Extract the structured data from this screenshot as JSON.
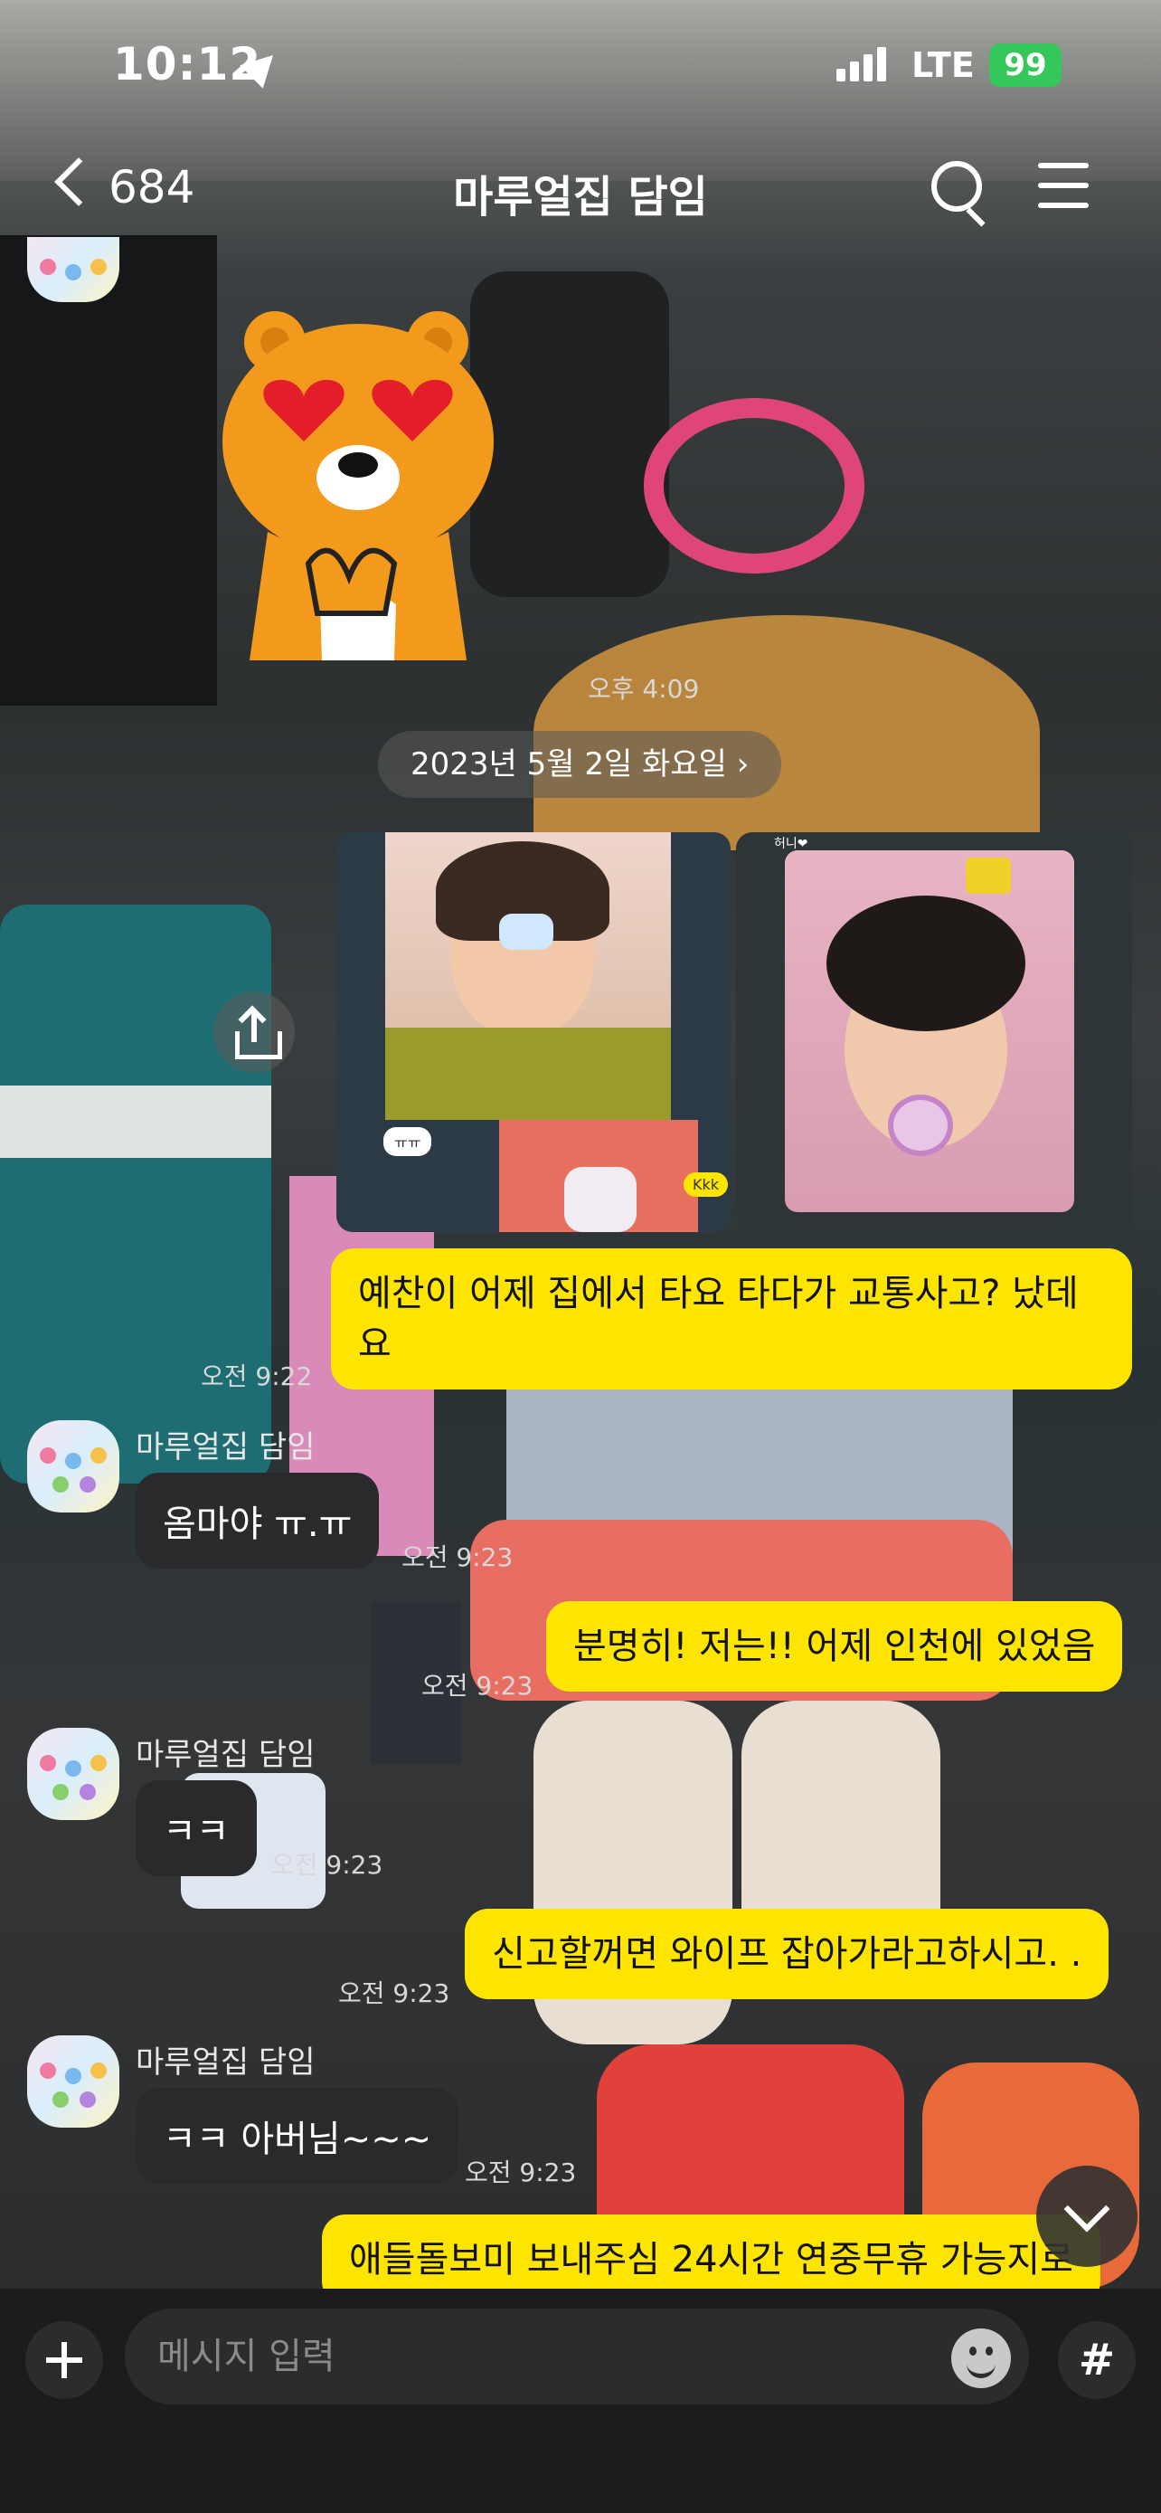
{
  "status_bar": {
    "time": "10:12",
    "network": "LTE",
    "battery": "99"
  },
  "header": {
    "back_count": "684",
    "title": "마루얼집 담임"
  },
  "date_divider": "2023년 5월 2일 화요일 ›",
  "messages": [
    {
      "id": "sticker",
      "sender": "",
      "time": "오후 4:09"
    },
    {
      "id": "photos",
      "time": "",
      "caption_left": "ㅠㅠ",
      "caption_right": "Kkk",
      "inner_sender": "허니❤"
    },
    {
      "id": "m1",
      "from": "me",
      "text": "예찬이 어제 집에서 타요 타다가 교통사고? 났데요",
      "time": "오전 9:22"
    },
    {
      "id": "m2",
      "from": "other",
      "sender": "마루얼집 담임",
      "text": "옴마야 ㅠ.ㅠ",
      "time": "오전 9:23"
    },
    {
      "id": "m3",
      "from": "me",
      "text": "분명히! 저는!! 어제 인천에 있었음",
      "time": "오전 9:23"
    },
    {
      "id": "m4",
      "from": "other",
      "sender": "마루얼집 담임",
      "text": "ㅋㅋ",
      "time": "오전 9:23"
    },
    {
      "id": "m5",
      "from": "me",
      "text": "신고할꺼면 와이프 잡아가라고하시고. .",
      "time": "오전 9:23"
    },
    {
      "id": "m6",
      "from": "other",
      "sender": "마루얼집 담임",
      "text": "ㅋㅋ 아버님~~~",
      "time": "오전 9:23"
    },
    {
      "id": "m7",
      "from": "me",
      "text": "애들돌보미 보내주심 24시간 연중무휴 가능지로",
      "time": ""
    }
  ],
  "input": {
    "placeholder": "메시지 입력",
    "hash_label": "#"
  },
  "colors": {
    "my_bubble": "#fee500",
    "other_bubble": "#2a2a2c",
    "battery": "#34c759"
  },
  "icons": [
    "back-chevron-icon",
    "location-arrow-icon",
    "search-icon",
    "menu-icon",
    "share-icon",
    "chevron-down-icon",
    "plus-icon",
    "emoji-icon"
  ]
}
